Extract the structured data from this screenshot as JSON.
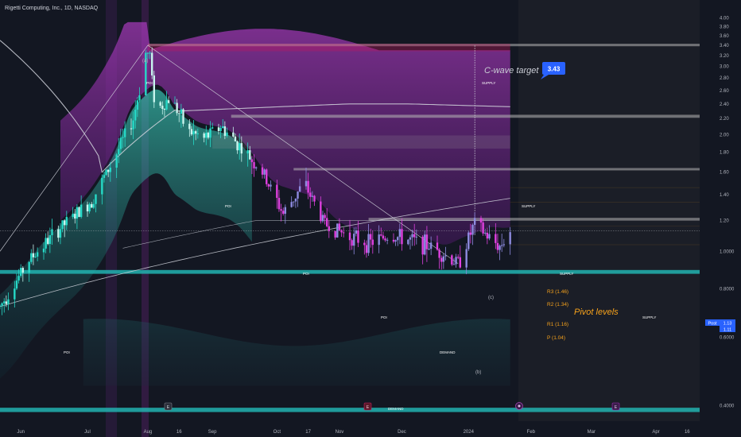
{
  "header": {
    "title": "Rigetti Computing, Inc., 1D, NASDAQ"
  },
  "colors": {
    "background": "#131722",
    "up_candle": "#26d9c7",
    "down_candle": "#e040e0",
    "cloud_purple": "#9c27b0",
    "cloud_teal": "#26c6b8",
    "supply_zone": "#b7b7b7",
    "demand_zone": "#22b3b0",
    "pivot_text": "#f7a21b",
    "target_label": "#2962ff",
    "price_label": "#2962ff"
  },
  "chart_data": {
    "type": "candlestick",
    "symbol": "Rigetti Computing, Inc.",
    "interval": "1D",
    "exchange": "NASDAQ",
    "y_axis": {
      "scale": "log",
      "range": [
        0.38,
        4.1
      ],
      "ticks": [
        "4.00",
        "3.80",
        "3.60",
        "3.40",
        "3.20",
        "3.00",
        "2.80",
        "2.60",
        "2.40",
        "2.20",
        "2.00",
        "1.80",
        "1.60",
        "1.40",
        "1.20",
        "1.0000",
        "0.8000",
        "0.6000",
        "0.4000"
      ]
    },
    "x_axis": {
      "range": [
        "2023-05-22",
        "2024-04-22"
      ],
      "ticks": [
        {
          "label": "Jun",
          "date": "2023-06-01"
        },
        {
          "label": "Jul",
          "date": "2023-07-03"
        },
        {
          "label": "Aug",
          "date": "2023-08-01"
        },
        {
          "label": "16",
          "date": "2023-08-16"
        },
        {
          "label": "Sep",
          "date": "2023-09-01"
        },
        {
          "label": "Oct",
          "date": "2023-10-02"
        },
        {
          "label": "17",
          "date": "2023-10-17"
        },
        {
          "label": "Nov",
          "date": "2023-11-01"
        },
        {
          "label": "Dec",
          "date": "2023-12-01"
        },
        {
          "label": "2024",
          "date": "2024-01-02"
        },
        {
          "label": "Feb",
          "date": "2024-02-01"
        },
        {
          "label": "Mar",
          "date": "2024-03-01"
        },
        {
          "label": "Apr",
          "date": "2024-04-01"
        },
        {
          "label": "16",
          "date": "2024-04-16"
        }
      ]
    },
    "price_path": [
      [
        "2023-05-22",
        0.72
      ],
      [
        "2023-06-05",
        0.95
      ],
      [
        "2023-06-20",
        1.15
      ],
      [
        "2023-07-05",
        1.35
      ],
      [
        "2023-07-15",
        1.7
      ],
      [
        "2023-07-25",
        2.2
      ],
      [
        "2023-08-01",
        3.3
      ],
      [
        "2023-08-05",
        2.3
      ],
      [
        "2023-08-12",
        2.5
      ],
      [
        "2023-08-20",
        2.05
      ],
      [
        "2023-08-28",
        1.95
      ],
      [
        "2023-09-05",
        2.1
      ],
      [
        "2023-09-15",
        1.85
      ],
      [
        "2023-09-25",
        1.6
      ],
      [
        "2023-10-05",
        1.25
      ],
      [
        "2023-10-15",
        1.5
      ],
      [
        "2023-10-25",
        1.18
      ],
      [
        "2023-11-05",
        1.1
      ],
      [
        "2023-11-15",
        1.05
      ],
      [
        "2023-11-25",
        1.1
      ],
      [
        "2023-12-05",
        1.07
      ],
      [
        "2023-12-15",
        1.03
      ],
      [
        "2023-12-28",
        0.93
      ],
      [
        "2024-01-05",
        1.18
      ],
      [
        "2024-01-12",
        1.08
      ],
      [
        "2024-01-17",
        1.03
      ],
      [
        "2024-01-22",
        1.13
      ]
    ],
    "zones": [
      {
        "type": "supply",
        "label": "SUPPLY",
        "low": 3.38,
        "high": 3.43,
        "start": "2023-08-01",
        "end": "2024-04-22"
      },
      {
        "type": "supply",
        "label": "SUPPLY",
        "low": 2.21,
        "high": 2.25,
        "start": "2023-09-10",
        "end": "2024-04-22"
      },
      {
        "type": "supply",
        "label": "SUPPLY",
        "low": 1.62,
        "high": 1.64,
        "start": "2023-10-10",
        "end": "2024-04-22"
      },
      {
        "type": "supply",
        "label": "SUPPLY",
        "low": 1.2,
        "high": 1.22,
        "start": "2023-11-15",
        "end": "2024-04-22"
      },
      {
        "type": "demand",
        "label": "DEMAND",
        "low": 0.875,
        "high": 0.895,
        "start": "2023-05-22",
        "end": "2024-04-22"
      },
      {
        "type": "demand",
        "label": "DEMAND",
        "low": 0.385,
        "high": 0.395,
        "start": "2023-05-22",
        "end": "2024-04-22"
      }
    ],
    "zone_tags": [
      "POI",
      "POI",
      "POI",
      "POI",
      "POI"
    ],
    "pivots": [
      {
        "label": "R3 (1.46)",
        "value": 1.46
      },
      {
        "label": "R2 (1.34)",
        "value": 1.34
      },
      {
        "label": "R1 (1.16)",
        "value": 1.16
      },
      {
        "label": "P (1.04)",
        "value": 1.04
      }
    ],
    "annotations": {
      "c_wave_target": "C-wave target",
      "target_value": "3.43",
      "pivot_levels": "Pivot levels",
      "wave_a": "(a)",
      "wave_b": "(b)",
      "wave_c": "(c)"
    },
    "last_price": {
      "post_label": "Post",
      "post_value": "1.13",
      "close_value": "1.11"
    },
    "event_markers": [
      "E",
      "E",
      "E"
    ]
  }
}
